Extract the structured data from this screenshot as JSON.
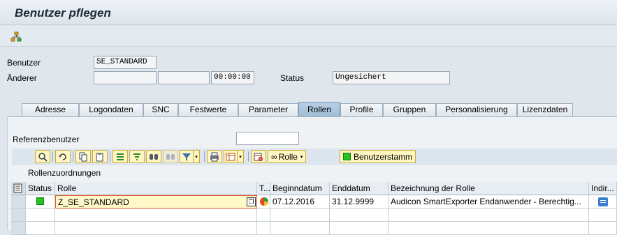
{
  "window": {
    "title": "Benutzer pflegen"
  },
  "toolbar": {
    "icon": "org-structure-icon"
  },
  "header": {
    "benutzer_label": "Benutzer",
    "benutzer_value": "SE_STANDARD",
    "aenderer_label": "Änderer",
    "aenderer_value": "",
    "aenderer_date": "",
    "aenderer_time": "00:00:00",
    "status_label": "Status",
    "status_value": "Ungesichert"
  },
  "tabs": [
    {
      "label": "Adresse"
    },
    {
      "label": "Logondaten"
    },
    {
      "label": "SNC"
    },
    {
      "label": "Festwerte"
    },
    {
      "label": "Parameter"
    },
    {
      "label": "Rollen",
      "active": true
    },
    {
      "label": "Profile"
    },
    {
      "label": "Gruppen"
    },
    {
      "label": "Personalisierung"
    },
    {
      "label": "Lizenzdaten"
    }
  ],
  "rollen": {
    "referenzbenutzer_label": "Referenzbenutzer",
    "referenzbenutzer_value": "",
    "toolbar_buttons": {
      "rolle_label": "Rolle",
      "benutzerstamm_label": "Benutzerstamm"
    },
    "section_title": "Rollenzuordnungen",
    "columns": [
      "Status",
      "Rolle",
      "T...",
      "Beginndatum",
      "Enddatum",
      "Bezeichnung der Rolle",
      "Indir..."
    ],
    "rows": [
      {
        "status": "green",
        "rolle": "Z_SE_STANDARD",
        "beginndatum": "07.12.2016",
        "enddatum": "31.12.9999",
        "bezeichnung": "Audicon SmartExporter Endanwender - Berechtig..."
      }
    ]
  },
  "colors": {
    "accent": "#9fbdd6",
    "status_green": "#22c41e",
    "button_yellow": "#fff6c2",
    "selected_cell": "#fff8c8"
  }
}
